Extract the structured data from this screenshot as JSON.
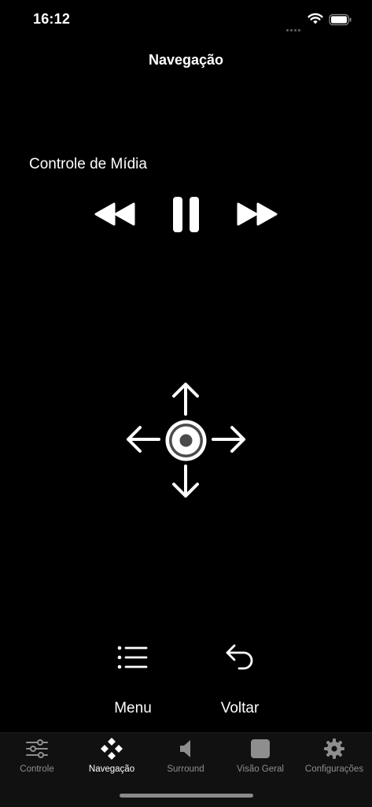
{
  "status_bar": {
    "time": "16:12"
  },
  "nav": {
    "title": "Navegação"
  },
  "media": {
    "section_title": "Controle de Mídia",
    "controls": [
      {
        "name": "rewind-icon"
      },
      {
        "name": "pause-icon"
      },
      {
        "name": "fast-forward-icon"
      }
    ]
  },
  "dpad": {
    "buttons": [
      "arrow-up-icon",
      "arrow-left-icon",
      "select-center-icon",
      "arrow-right-icon",
      "arrow-down-icon"
    ]
  },
  "actions": {
    "menu_label": "Menu",
    "menu_icon": "list-icon",
    "back_label": "Voltar",
    "back_icon": "undo-arrow-icon"
  },
  "tab_bar": {
    "tabs": [
      {
        "label": "Controle",
        "icon": "sliders-icon",
        "active": false
      },
      {
        "label": "Navegação",
        "icon": "gamepad-dpad-icon",
        "active": true
      },
      {
        "label": "Surround",
        "icon": "speaker-icon",
        "active": false
      },
      {
        "label": "Visão Geral",
        "icon": "square-icon",
        "active": false
      },
      {
        "label": "Configurações",
        "icon": "gear-icon",
        "active": false
      }
    ]
  },
  "colors": {
    "background": "#000000",
    "foreground": "#ffffff",
    "tab_inactive": "#8e8e8e",
    "tab_bar_background": "#111111"
  }
}
